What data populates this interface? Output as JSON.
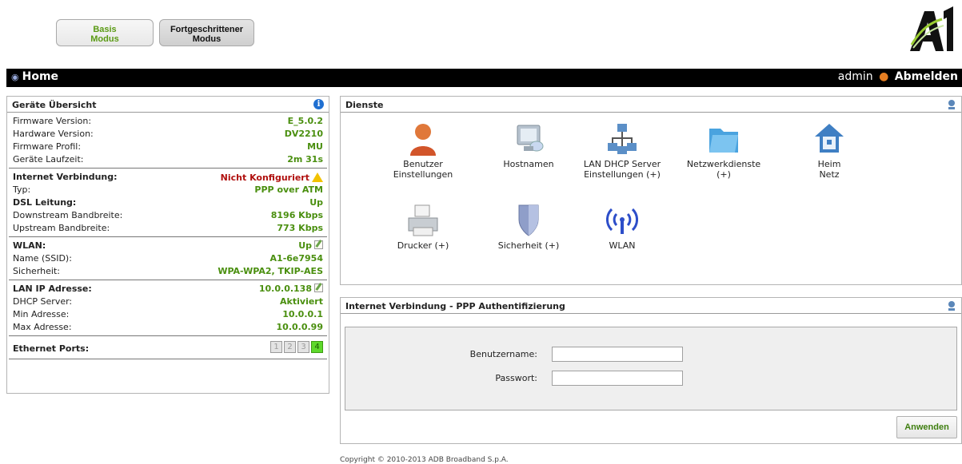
{
  "modes": {
    "basic": "Basis\nModus",
    "advanced": "Fortgeschrittener\nModus"
  },
  "logo_text": "A1",
  "topbar": {
    "home": "Home",
    "username": "admin",
    "logout": "Abmelden"
  },
  "overview": {
    "title": "Geräte Übersicht",
    "device": [
      {
        "label": "Firmware Version:",
        "value": "E_5.0.2"
      },
      {
        "label": "Hardware Version:",
        "value": "DV2210"
      },
      {
        "label": "Firmware Profil:",
        "value": "MU"
      },
      {
        "label": "Geräte Laufzeit:",
        "value": "2m 31s"
      }
    ],
    "internet": [
      {
        "label": "Internet Verbindung:",
        "value": "Nicht Konfiguriert"
      },
      {
        "label": "Typ:",
        "value": "PPP over ATM"
      },
      {
        "label": "DSL Leitung:",
        "value": "Up"
      },
      {
        "label": "Downstream Bandbreite:",
        "value": "8196 Kbps"
      },
      {
        "label": "Upstream Bandbreite:",
        "value": "773 Kbps"
      }
    ],
    "wlan": [
      {
        "label": "WLAN:",
        "value": "Up"
      },
      {
        "label": "Name (SSID):",
        "value": "A1-6e7954"
      },
      {
        "label": "Sicherheit:",
        "value": "WPA-WPA2, TKIP-AES"
      }
    ],
    "lan": [
      {
        "label": "LAN IP Adresse:",
        "value": "10.0.0.138"
      },
      {
        "label": "DHCP Server:",
        "value": "Aktiviert"
      },
      {
        "label": "Min Adresse:",
        "value": "10.0.0.1"
      },
      {
        "label": "Max Adresse:",
        "value": "10.0.0.99"
      }
    ],
    "ethernet": {
      "label": "Ethernet Ports:",
      "ports": [
        "1",
        "2",
        "3",
        "4"
      ],
      "active_port": "4"
    }
  },
  "services": {
    "title": "Dienste",
    "items": [
      {
        "label": "Benutzer\nEinstellungen",
        "icon": "user-icon"
      },
      {
        "label": "Hostnamen",
        "icon": "monitor-icon"
      },
      {
        "label": "LAN DHCP Server\nEinstellungen (+)",
        "icon": "network-icon"
      },
      {
        "label": "Netzwerkdienste\n(+)",
        "icon": "folder-icon"
      },
      {
        "label": "Heim\nNetz",
        "icon": "house-icon"
      },
      {
        "label": "Drucker (+)",
        "icon": "printer-icon"
      },
      {
        "label": "Sicherheit (+)",
        "icon": "shield-icon"
      },
      {
        "label": "WLAN",
        "icon": "wifi-icon"
      }
    ]
  },
  "ppp": {
    "title": "Internet Verbindung - PPP Authentifizierung",
    "username_label": "Benutzername:",
    "username_value": "",
    "password_label": "Passwort:",
    "password_value": "",
    "apply": "Anwenden"
  },
  "copyright": "Copyright © 2010-2013 ADB Broadband S.p.A.",
  "colors": {
    "accent_green": "#4a8f0f",
    "alert_red": "#b0100e",
    "topbar": "#000000"
  }
}
